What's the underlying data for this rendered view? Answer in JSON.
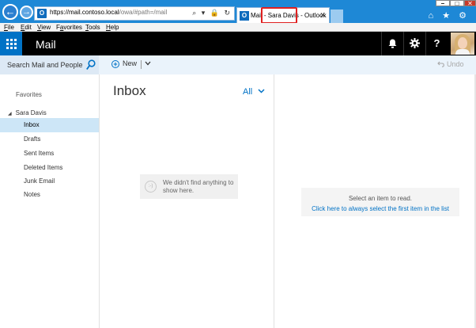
{
  "browser": {
    "url_host": "https://mail.contoso.local",
    "url_path": "/owa/#path=/mail",
    "address_icons": "⌕ ▾ 🔒 ↻",
    "tab_title": "Mail - Sara Davis - Outlook",
    "favicon_letter": "O",
    "tab_close": "✕",
    "window_buttons": {
      "minimize": "–",
      "maximize": "□",
      "close": "✕"
    },
    "nav_back": "←",
    "nav_forward": "→",
    "chrome_icons": "⌂ ★ ⚙"
  },
  "menubar": {
    "items": [
      {
        "label": "File",
        "underline": "F"
      },
      {
        "label": "Edit",
        "underline": "E"
      },
      {
        "label": "View",
        "underline": "V"
      },
      {
        "label": "Favorites",
        "underline": "a"
      },
      {
        "label": "Tools",
        "underline": "T"
      },
      {
        "label": "Help",
        "underline": "H"
      }
    ]
  },
  "header": {
    "app_title": "Mail",
    "icons": {
      "bell": "bell-icon",
      "gear": "gear-icon",
      "help": "?"
    },
    "colors": {
      "brand": "#0072c6",
      "bar": "#000000"
    }
  },
  "commandbar": {
    "search_label": "Search Mail and People",
    "new_label": "New",
    "undo_label": "Undo"
  },
  "leftnav": {
    "favorites_label": "Favorites",
    "account_name": "Sara Davis",
    "folders": [
      {
        "label": "Inbox",
        "selected": true
      },
      {
        "label": "Drafts",
        "selected": false
      },
      {
        "label": "Sent Items",
        "selected": false
      },
      {
        "label": "Deleted Items",
        "selected": false
      },
      {
        "label": "Junk Email",
        "selected": false
      },
      {
        "label": "Notes",
        "selected": false
      }
    ]
  },
  "messagelist": {
    "title": "Inbox",
    "filter_label": "All",
    "empty_face": ":-)",
    "empty_text": "We didn't find anything to show here."
  },
  "readingpane": {
    "message": "Select an item to read.",
    "link": "Click here to always select the first item in the list"
  }
}
